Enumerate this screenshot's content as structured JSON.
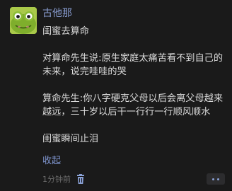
{
  "post": {
    "username": "古他那",
    "paragraphs": [
      "闺蜜去算命",
      "对算命先生说:原生家庭太痛苦看不到自己的未来，说完哇哇的哭",
      "算命先生:你八字硬克父母以后会离父母越来越远，三十岁以后干一行行一行顺风顺水",
      "闺蜜瞬间止泪"
    ],
    "collapse_label": "收起",
    "time": "1分钟前"
  },
  "icons": {
    "avatar": "frog-avatar",
    "delete": "trash-icon",
    "more": "more-dots-icon"
  },
  "colors": {
    "background": "#1a1a1a",
    "username": "#8a9ed3",
    "text": "#dcdcdc",
    "link": "#7f95cf",
    "meta": "#6d6d6d"
  }
}
